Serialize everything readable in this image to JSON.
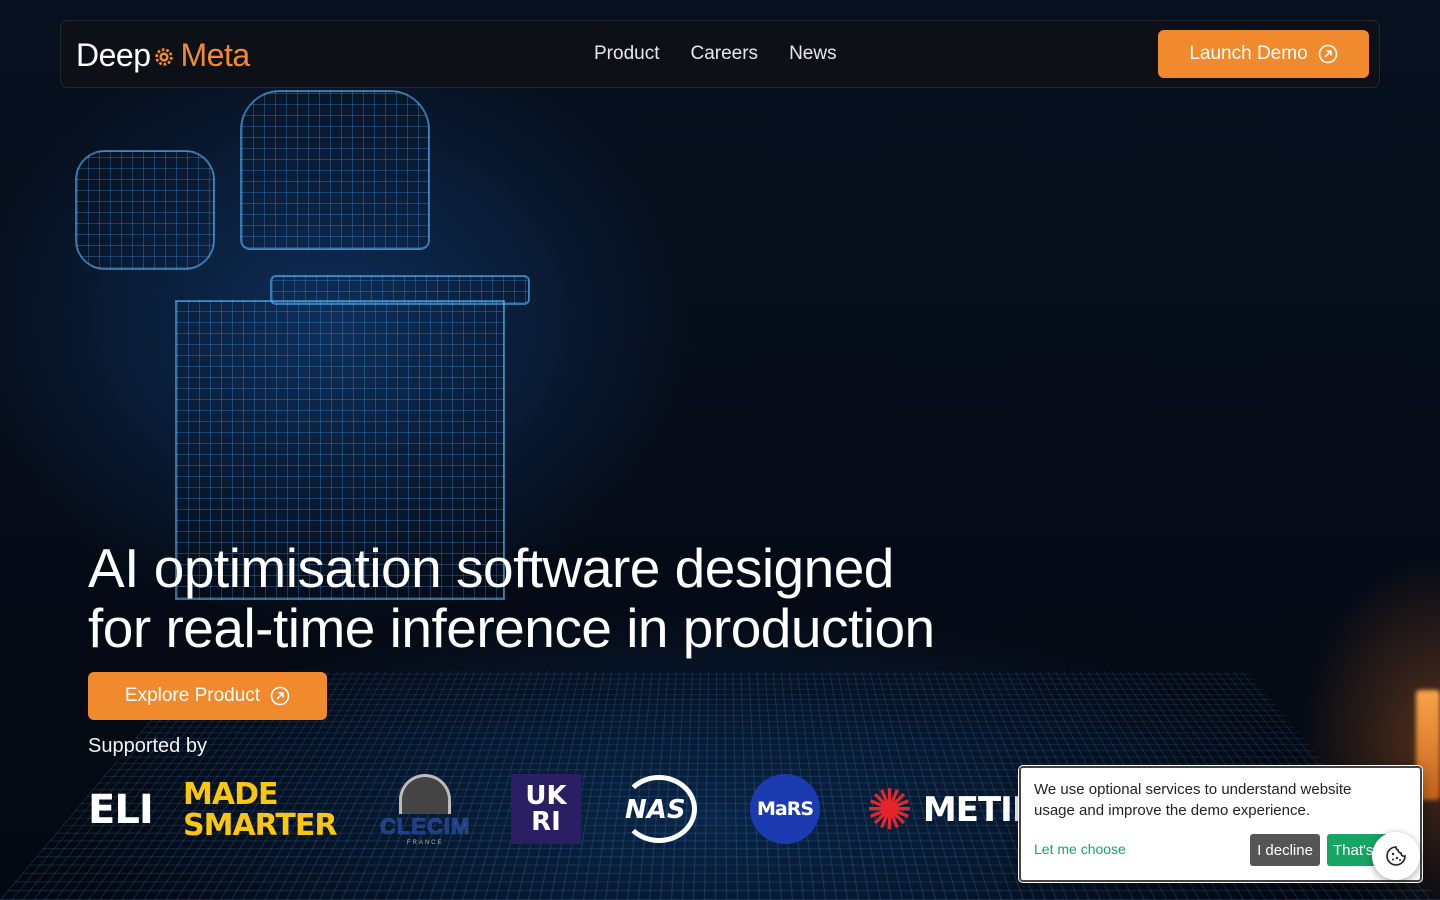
{
  "brand": {
    "part1": "Deep",
    "part2": "Meta",
    "accent_color": "#f08a2d"
  },
  "nav": {
    "items": [
      {
        "label": "Product"
      },
      {
        "label": "Careers"
      },
      {
        "label": "News"
      }
    ],
    "cta_label": "Launch Demo",
    "cta_icon": "arrow-up-right-circle-icon"
  },
  "hero": {
    "headline_line1": "AI optimisation software designed",
    "headline_line2": "for real-time inference in production",
    "button_label": "Explore Product",
    "supported_by": "Supported by"
  },
  "partners": {
    "eli": "ELI",
    "made_line1": "MADE",
    "made_line2": "SMARTER",
    "clecim": "CLECIM",
    "clecim_sub": "FRANCE",
    "ukri_line1": "UK",
    "ukri_line2": "RI",
    "nasa": "NAS",
    "mars": "MaRS",
    "metin": "METIN"
  },
  "cookie": {
    "message": "We use optional services to understand website usage and improve the demo experience.",
    "choose_label": "Let me choose",
    "decline_label": "I decline",
    "accept_label": "That's ok",
    "fab_icon": "cookie-icon"
  }
}
